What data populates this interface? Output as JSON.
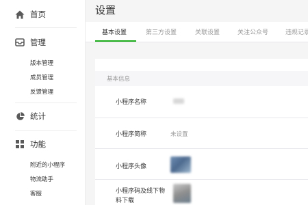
{
  "sidebar": {
    "home": {
      "label": "首页",
      "icon": "home-icon"
    },
    "manage": {
      "label": "管理",
      "icon": "inbox-icon",
      "items": [
        {
          "label": "版本管理"
        },
        {
          "label": "成员管理"
        },
        {
          "label": "反馈管理"
        }
      ]
    },
    "stats": {
      "label": "统计",
      "icon": "pie-chart-icon"
    },
    "features": {
      "label": "功能",
      "icon": "grid-icon",
      "items": [
        {
          "label": "附近的小程序"
        },
        {
          "label": "物流助手"
        },
        {
          "label": "客服"
        }
      ]
    }
  },
  "main": {
    "title": "设置",
    "tabs": [
      {
        "label": "基本设置",
        "active": true
      },
      {
        "label": "第三方设置"
      },
      {
        "label": "关联设置"
      },
      {
        "label": "关注公众号"
      },
      {
        "label": "违规记录"
      }
    ],
    "section_title": "基本信息",
    "rows": [
      {
        "label": "小程序名称",
        "value": ""
      },
      {
        "label": "小程序简称",
        "value": "未设置"
      },
      {
        "label": "小程序头像",
        "value": ""
      },
      {
        "label": "小程序码及线下物",
        "label2": "料下载",
        "value": ""
      }
    ]
  },
  "colors": {
    "accent": "#1aad19",
    "icon": "#5a5a5a",
    "muted": "#9a9a9a"
  }
}
